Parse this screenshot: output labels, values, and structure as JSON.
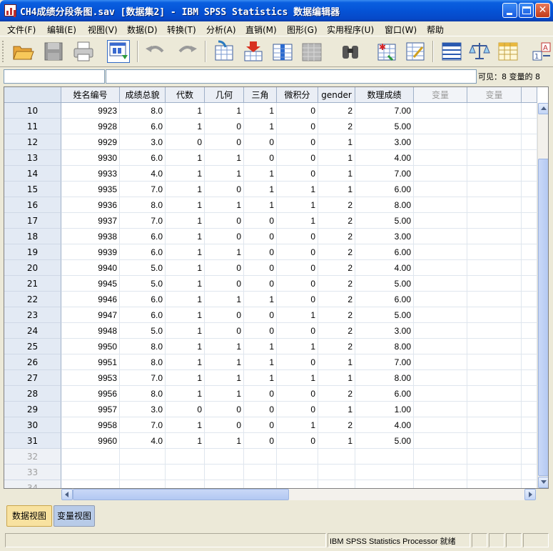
{
  "window": {
    "title": "CH4成绩分段条图.sav [数据集2] - IBM SPSS Statistics 数据编辑器",
    "close_glyph": "✕"
  },
  "menu": [
    "文件(F)",
    "编辑(E)",
    "视图(V)",
    "数据(D)",
    "转换(T)",
    "分析(A)",
    "直销(M)",
    "图形(G)",
    "实用程序(U)",
    "窗口(W)",
    "帮助"
  ],
  "toolbar": {
    "icons": [
      "open-folder-icon",
      "save-icon",
      "print-icon",
      "dialog-recall-icon",
      "undo-icon",
      "redo-icon",
      "goto-case-icon",
      "insert-cases-icon",
      "insert-variable-icon",
      "split-file-icon",
      "find-icon",
      "select-cases-icon",
      "value-labels-icon",
      "variable-sets-icon",
      "weight-cases-icon",
      "use-sets-icon",
      "variables-icon"
    ]
  },
  "editbar": {
    "cell_ref": "",
    "cell_value": "",
    "visible": "可见：8 变量的 8"
  },
  "grid": {
    "columns": [
      "姓名编号",
      "成绩总貌",
      "代数",
      "几何",
      "三角",
      "微积分",
      "gender",
      "数理成绩",
      "变量",
      "变量"
    ],
    "rows": [
      {
        "n": "10",
        "v": [
          "9923",
          "8.0",
          "1",
          "1",
          "1",
          "0",
          "2",
          "7.00"
        ]
      },
      {
        "n": "11",
        "v": [
          "9928",
          "6.0",
          "1",
          "0",
          "1",
          "0",
          "2",
          "5.00"
        ]
      },
      {
        "n": "12",
        "v": [
          "9929",
          "3.0",
          "0",
          "0",
          "0",
          "0",
          "1",
          "3.00"
        ]
      },
      {
        "n": "13",
        "v": [
          "9930",
          "6.0",
          "1",
          "1",
          "0",
          "0",
          "1",
          "4.00"
        ]
      },
      {
        "n": "14",
        "v": [
          "9933",
          "4.0",
          "1",
          "1",
          "1",
          "0",
          "1",
          "7.00"
        ]
      },
      {
        "n": "15",
        "v": [
          "9935",
          "7.0",
          "1",
          "0",
          "1",
          "1",
          "1",
          "6.00"
        ]
      },
      {
        "n": "16",
        "v": [
          "9936",
          "8.0",
          "1",
          "1",
          "1",
          "1",
          "2",
          "8.00"
        ]
      },
      {
        "n": "17",
        "v": [
          "9937",
          "7.0",
          "1",
          "0",
          "0",
          "1",
          "2",
          "5.00"
        ]
      },
      {
        "n": "18",
        "v": [
          "9938",
          "6.0",
          "1",
          "0",
          "0",
          "0",
          "2",
          "3.00"
        ]
      },
      {
        "n": "19",
        "v": [
          "9939",
          "6.0",
          "1",
          "1",
          "0",
          "0",
          "2",
          "6.00"
        ]
      },
      {
        "n": "20",
        "v": [
          "9940",
          "5.0",
          "1",
          "0",
          "0",
          "0",
          "2",
          "4.00"
        ]
      },
      {
        "n": "21",
        "v": [
          "9945",
          "5.0",
          "1",
          "0",
          "0",
          "0",
          "2",
          "5.00"
        ]
      },
      {
        "n": "22",
        "v": [
          "9946",
          "6.0",
          "1",
          "1",
          "1",
          "0",
          "2",
          "6.00"
        ]
      },
      {
        "n": "23",
        "v": [
          "9947",
          "6.0",
          "1",
          "0",
          "0",
          "1",
          "2",
          "5.00"
        ]
      },
      {
        "n": "24",
        "v": [
          "9948",
          "5.0",
          "1",
          "0",
          "0",
          "0",
          "2",
          "3.00"
        ]
      },
      {
        "n": "25",
        "v": [
          "9950",
          "8.0",
          "1",
          "1",
          "1",
          "1",
          "2",
          "8.00"
        ]
      },
      {
        "n": "26",
        "v": [
          "9951",
          "8.0",
          "1",
          "1",
          "1",
          "0",
          "1",
          "7.00"
        ]
      },
      {
        "n": "27",
        "v": [
          "9953",
          "7.0",
          "1",
          "1",
          "1",
          "1",
          "1",
          "8.00"
        ]
      },
      {
        "n": "28",
        "v": [
          "9956",
          "8.0",
          "1",
          "1",
          "0",
          "0",
          "2",
          "6.00"
        ]
      },
      {
        "n": "29",
        "v": [
          "9957",
          "3.0",
          "0",
          "0",
          "0",
          "0",
          "1",
          "1.00"
        ]
      },
      {
        "n": "30",
        "v": [
          "9958",
          "7.0",
          "1",
          "0",
          "0",
          "1",
          "2",
          "4.00"
        ]
      },
      {
        "n": "31",
        "v": [
          "9960",
          "4.0",
          "1",
          "1",
          "0",
          "0",
          "1",
          "5.00"
        ]
      },
      {
        "n": "32",
        "v": []
      },
      {
        "n": "33",
        "v": []
      },
      {
        "n": "34",
        "v": []
      }
    ]
  },
  "tabs": {
    "data_view": "数据视图",
    "variable_view": "变量视图"
  },
  "status": {
    "text": "IBM SPSS Statistics Processor 就绪"
  },
  "colors": {
    "title_bar": "#0553D6",
    "active_tab": "#F8E2A0",
    "inactive_tab": "#B8CBE8",
    "row_header": "#E3EAF4"
  }
}
